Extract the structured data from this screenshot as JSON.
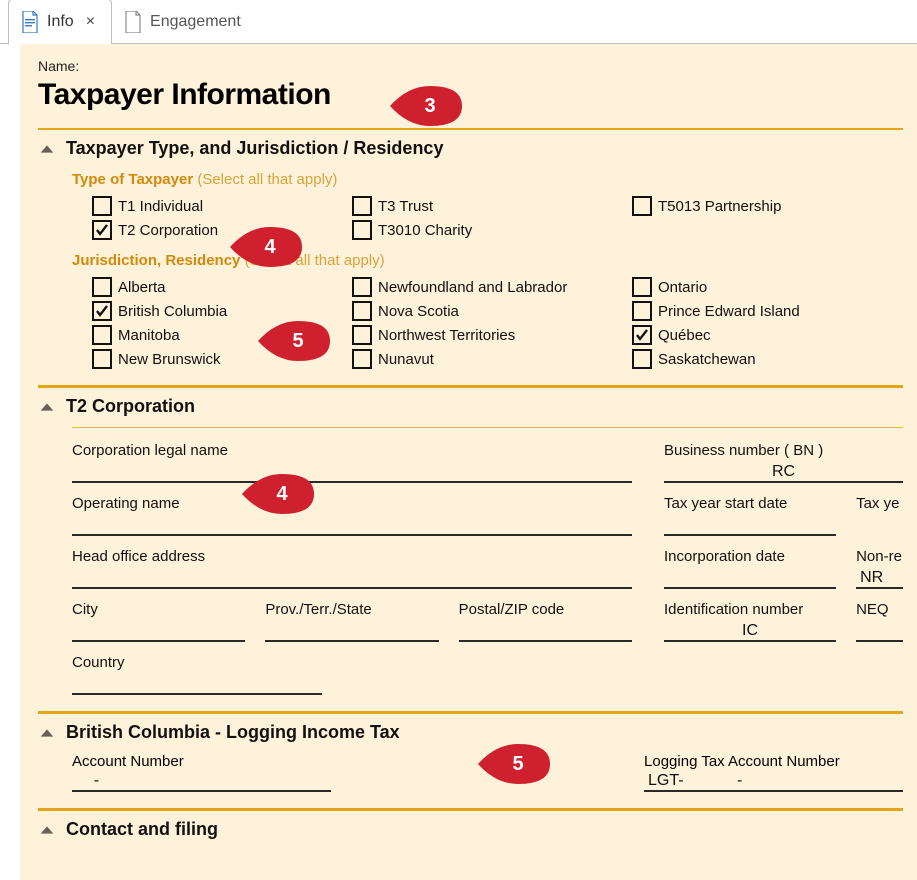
{
  "tabs": {
    "active": "Info",
    "other": "Engagement"
  },
  "form": {
    "name_label": "Name:",
    "title": "Taxpayer Information"
  },
  "section_type": {
    "heading": "Taxpayer Type, and Jurisdiction / Residency",
    "taxpayer_heading": "Type of Taxpayer",
    "taxpayer_paren": "(Select all that apply)",
    "jurisdiction_heading": "Jurisdiction, Residency",
    "jurisdiction_paren": "(Select all that apply)",
    "types": {
      "t1": "T1 Individual",
      "t2": "T2 Corporation",
      "t3": "T3 Trust",
      "t3010": "T3010 Charity",
      "t5013": "T5013 Partnership"
    },
    "provinces": {
      "ab": "Alberta",
      "bc": "British Columbia",
      "mb": "Manitoba",
      "nb": "New Brunswick",
      "nl": "Newfoundland and Labrador",
      "ns": "Nova Scotia",
      "nt": "Northwest Territories",
      "nu": "Nunavut",
      "on": "Ontario",
      "pe": "Prince Edward Island",
      "qc": "Québec",
      "sk": "Saskatchewan"
    }
  },
  "section_t2": {
    "heading": "T2 Corporation",
    "legal_name": "Corporation legal name",
    "operating_name": "Operating name",
    "head_office": "Head office address",
    "city": "City",
    "prov": "Prov./Terr./State",
    "postal": "Postal/ZIP code",
    "country": "Country",
    "bn_label": "Business number ( BN )",
    "bn_value": "RC",
    "tystart": "Tax year start date",
    "tyend": "Tax ye",
    "incorp": "Incorporation date",
    "nonres": "Non-re",
    "nr_value": "NR",
    "idnum": "Identification number",
    "ic_value": "IC",
    "neq": "NEQ"
  },
  "section_bc": {
    "heading": "British Columbia - Logging Income Tax",
    "acct": "Account Number",
    "acct_value": "    -",
    "log_acct": "Logging Tax Account Number",
    "log_value": "LGT-            -"
  },
  "section_contact": {
    "heading": "Contact and filing"
  },
  "callouts": {
    "c3": "3",
    "c4": "4",
    "c4b": "4",
    "c5": "5",
    "c5b": "5"
  }
}
